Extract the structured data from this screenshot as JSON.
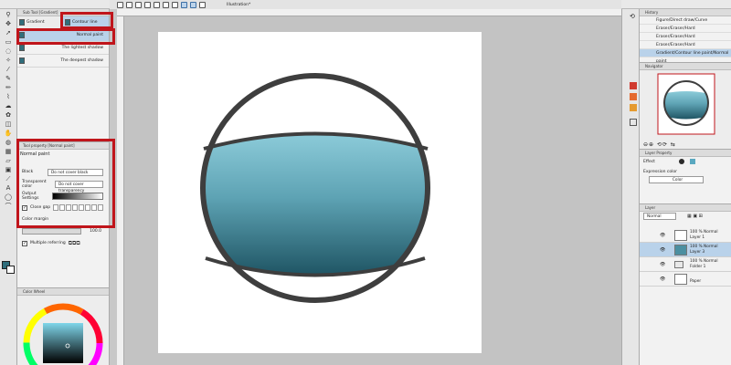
{
  "canvas_tab": "Illustration*",
  "subtool": {
    "header": "Sub Tool [Gradient]",
    "tabs": [
      "Gradient",
      "Contour line paint"
    ],
    "items": [
      "Normal paint",
      "The lightest shadow",
      "The deepest shadow"
    ],
    "selected": "Normal paint"
  },
  "tool_property": {
    "header": "Tool property [Normal paint]",
    "title": "Normal paint",
    "black_label": "Black",
    "black_value": "Do not cover black",
    "transparent_label": "Transparent color",
    "transparent_value": "Do not cover transparency",
    "output_label": "Output Settings",
    "close_gap_label": "Close gap",
    "color_margin_label": "Color margin",
    "color_margin_value": "100.0",
    "multiple_label": "Multiple referring"
  },
  "color_wheel": {
    "header": "Color Wheel"
  },
  "history": {
    "header": "History",
    "items": [
      "Figure/Direct draw/Curve",
      "Eraser/Eraser/Hard",
      "Eraser/Eraser/Hard",
      "Eraser/Eraser/Hard",
      "Gradient/Contour line paint/Normal paint"
    ],
    "selected": "Gradient/Contour line paint/Normal paint"
  },
  "navigator": {
    "header": "Navigator"
  },
  "layer_property": {
    "header": "Layer Property",
    "effect_label": "Effect",
    "expression_label": "Expression color",
    "expression_value": "Color"
  },
  "layers": {
    "header": "Layer",
    "blend": "Normal",
    "rows": [
      {
        "mode": "100 % Normal",
        "name": "Layer 1",
        "selected": false
      },
      {
        "mode": "100 % Normal",
        "name": "Layer 3",
        "selected": true
      },
      {
        "mode": "100 % Normal",
        "name": "Folder 1",
        "selected": false
      },
      {
        "mode": "",
        "name": "Paper",
        "selected": false
      }
    ]
  },
  "colors": {
    "accent": "#2f6e7c",
    "highlight": "#c0151b",
    "selection": "#b9d2ea"
  }
}
